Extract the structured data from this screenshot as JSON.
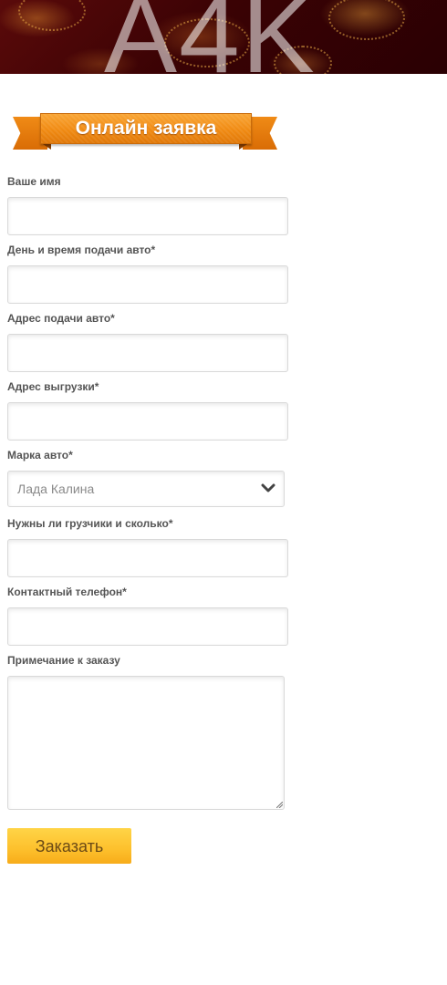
{
  "header": {
    "logo_text": "A4K"
  },
  "form": {
    "title": "Онлайн заявка",
    "fields": [
      {
        "label": "Ваше имя",
        "value": ""
      },
      {
        "label": "День и время подачи авто*",
        "value": ""
      },
      {
        "label": "Адрес подачи авто*",
        "value": ""
      },
      {
        "label": "Адрес выгрузки*",
        "value": ""
      },
      {
        "label": "Марка авто*",
        "value": "Лада Калина"
      },
      {
        "label": "Нужны ли грузчики и сколько*",
        "value": ""
      },
      {
        "label": "Контактный телефон*",
        "value": ""
      },
      {
        "label": "Примечание к заказу",
        "value": ""
      }
    ],
    "submit_label": "Заказать"
  },
  "icons": {
    "select_arrow": "chevron-down-icon",
    "resize": "resize-grip-icon"
  },
  "colors": {
    "ribbon": "#f08a12",
    "button": "#fdc02c",
    "button_text": "#6b4a16",
    "header_bg": "#3a0204"
  }
}
